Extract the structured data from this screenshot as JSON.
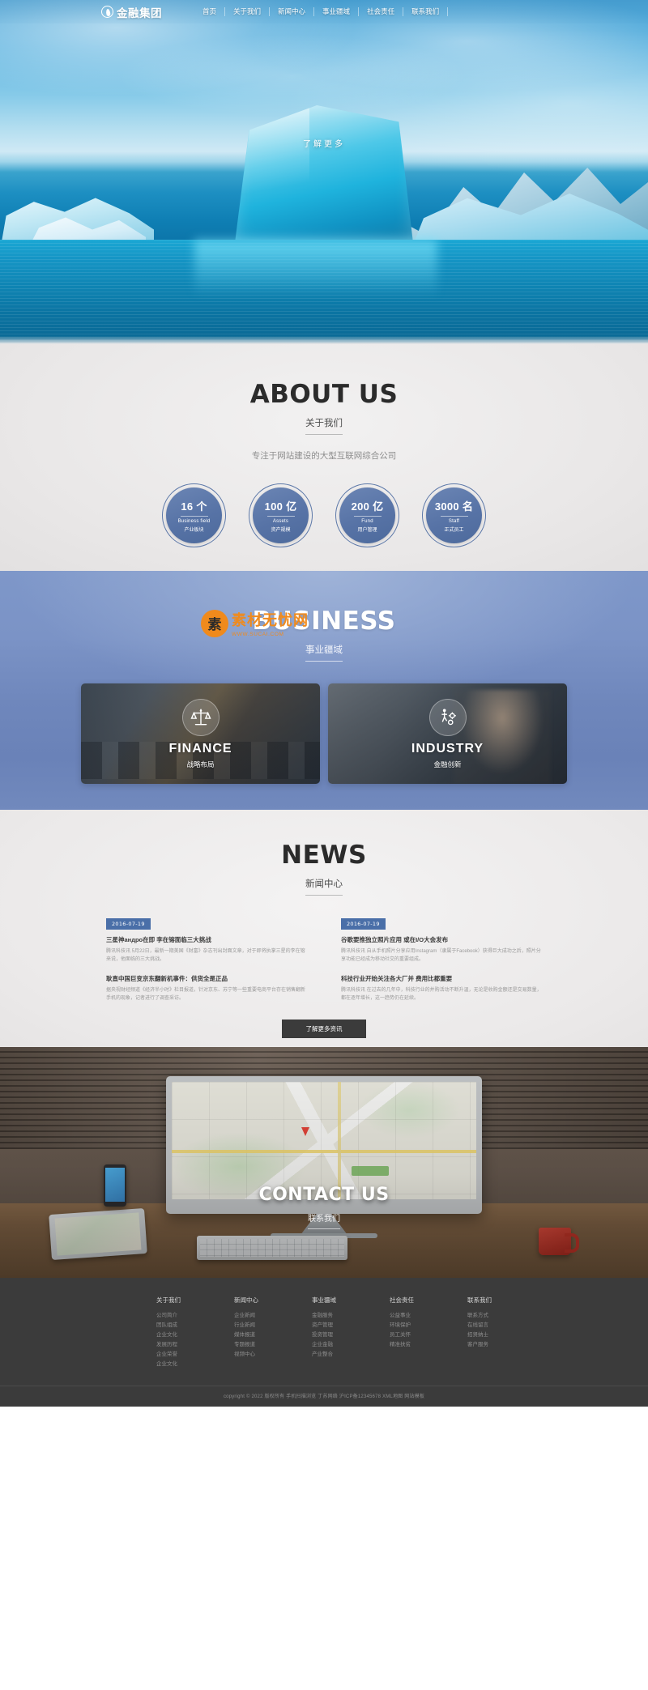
{
  "header": {
    "brand": "金融集团",
    "logo_icon": "flame-droplet-logo-icon",
    "nav": [
      {
        "label": "首页"
      },
      {
        "label": "关于我们"
      },
      {
        "label": "新闻中心"
      },
      {
        "label": "事业疆域"
      },
      {
        "label": "社会责任"
      },
      {
        "label": "联系我们"
      }
    ]
  },
  "hero": {
    "cta": "了解更多",
    "image_alt": "iceberg-ocean-photo"
  },
  "about": {
    "title_en": "ABOUT US",
    "title_cn": "关于我们",
    "subtitle": "专注于网站建设的大型互联网综合公司",
    "stats": [
      {
        "number": "16 个",
        "en": "Business field",
        "cn": "产业板块"
      },
      {
        "number": "100 亿",
        "en": "Assets",
        "cn": "资产规模"
      },
      {
        "number": "200 亿",
        "en": "Fund",
        "cn": "用户管理"
      },
      {
        "number": "3000 名",
        "en": "Staff",
        "cn": "正式员工"
      }
    ]
  },
  "business": {
    "title_en": "BUSINESS",
    "title_cn": "事业疆域",
    "cards": [
      {
        "en": "FINANCE",
        "cn": "战略布局",
        "icon": "balance-scale-icon"
      },
      {
        "en": "INDUSTRY",
        "cn": "金融创新",
        "icon": "person-gears-icon"
      }
    ]
  },
  "watermark": {
    "badge": "素",
    "title": "素材无忧网",
    "url": "WWW.SUCAI.COM"
  },
  "news": {
    "title_en": "NEWS",
    "title_cn": "新闻中心",
    "more_label": "了解更多资讯",
    "items": [
      {
        "date": "2016-07-19",
        "title": "三星神андро在即 李在镕面临三大挑战",
        "desc": "腾讯科技讯 5月22日，最新一期美国《财富》杂志刊出封面文章，对于即将执掌三星的李在镕来说，他面临的三大挑战。"
      },
      {
        "date": "2016-07-19",
        "title": "谷歌要推独立照片应用 或在I/O大会发布",
        "desc": "腾讯科技讯 自从手机照片分享应用Instagram（隶属于Facebook）获得巨大成功之后，照片分享功能已经成为移动社交的重要组成。"
      },
      {
        "date": "2016-07-19",
        "title": "耿直中国巨变京东翻新机事件：供货全是正品",
        "desc": "据央视财经频道《经济半小时》栏目报道，针对京东、苏宁等一些重要电商平台存在销售翻新手机的现象，记者进行了调查采访。"
      },
      {
        "date": "2016-07-19",
        "title": "科技行业开始关注各大厂并 费用比都重要",
        "desc": "腾讯科技讯 在过去的几年中，科技行业的并购活动不断升温，无论是收购金额还是交易数量，都在逐年增长，这一趋势仍在延续。"
      }
    ]
  },
  "contact": {
    "title_en": "CONTACT US",
    "title_cn": "联系我们"
  },
  "footer": {
    "columns": [
      {
        "title": "关于我们",
        "links": [
          "公司简介",
          "团队组成",
          "企业文化",
          "发展历程",
          "企业荣誉",
          "企业文化"
        ]
      },
      {
        "title": "新闻中心",
        "links": [
          "企业新闻",
          "行业新闻",
          "媒体报道",
          "专题报道",
          "视频中心"
        ]
      },
      {
        "title": "事业疆域",
        "links": [
          "金融服务",
          "资产管理",
          "投资管理",
          "企业金融",
          "产业整合"
        ]
      },
      {
        "title": "社会责任",
        "links": [
          "公益事业",
          "环境保护",
          "员工关怀",
          "精准扶贫"
        ]
      },
      {
        "title": "联系我们",
        "links": [
          "联系方式",
          "在线留言",
          "招贤纳士",
          "客户服务"
        ]
      }
    ],
    "copyright": "copyright © 2022 版权所有 手机扫描浏览 丁苏网络 沪ICP备12345678 XML地图 网站模板"
  },
  "colors": {
    "brand_blue": "#4a6fa8",
    "business_bg": "#7189bd",
    "stat_circle": "#5773a6",
    "footer_bg": "#3b3b3b",
    "accent_orange": "#f08a1c"
  }
}
